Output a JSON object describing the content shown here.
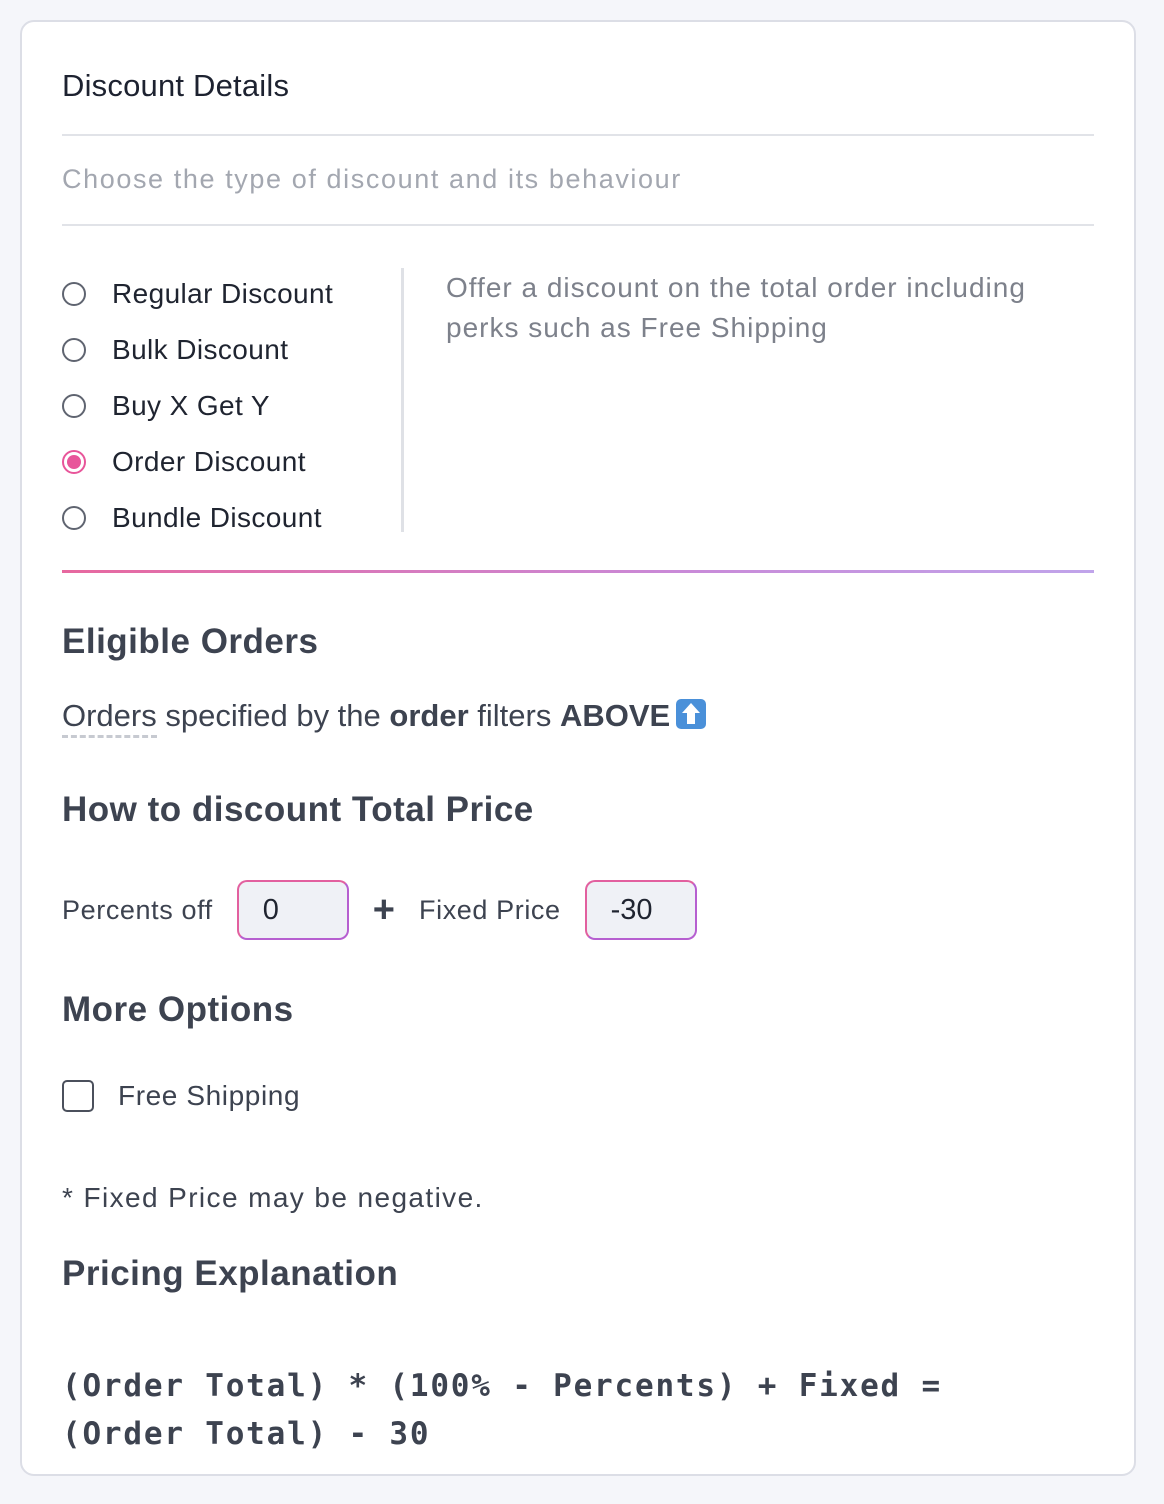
{
  "header": {
    "title": "Discount Details",
    "subtitle": "Choose the type of discount and its behaviour"
  },
  "discount_types": {
    "options": [
      {
        "label": "Regular Discount",
        "selected": false
      },
      {
        "label": "Bulk Discount",
        "selected": false
      },
      {
        "label": "Buy X Get Y",
        "selected": false
      },
      {
        "label": "Order Discount",
        "selected": true
      },
      {
        "label": "Bundle Discount",
        "selected": false
      }
    ],
    "description": "Offer a discount on the total order including perks such as Free Shipping"
  },
  "eligible_orders": {
    "heading": "Eligible Orders",
    "text_orders": "Orders",
    "text_specified": " specified by the ",
    "text_order_bold": "order",
    "text_filters": " filters ",
    "text_above": "ABOVE",
    "icon": "up-arrow-icon"
  },
  "pricing": {
    "heading": "How to discount Total Price",
    "percents_label": "Percents off",
    "percents_value": "0",
    "plus_symbol": "+",
    "fixed_label": "Fixed Price",
    "fixed_value": "-30"
  },
  "more_options": {
    "heading": "More Options",
    "free_shipping_label": "Free Shipping",
    "free_shipping_checked": false,
    "note": "* Fixed Price may be negative."
  },
  "explanation": {
    "heading": "Pricing Explanation",
    "formula_line1": "(Order Total) * (100% - Percents) + Fixed =",
    "formula_line2": "(Order Total) - 30"
  },
  "colors": {
    "accent_pink": "#e8559a",
    "accent_purple": "#b65fd0"
  }
}
